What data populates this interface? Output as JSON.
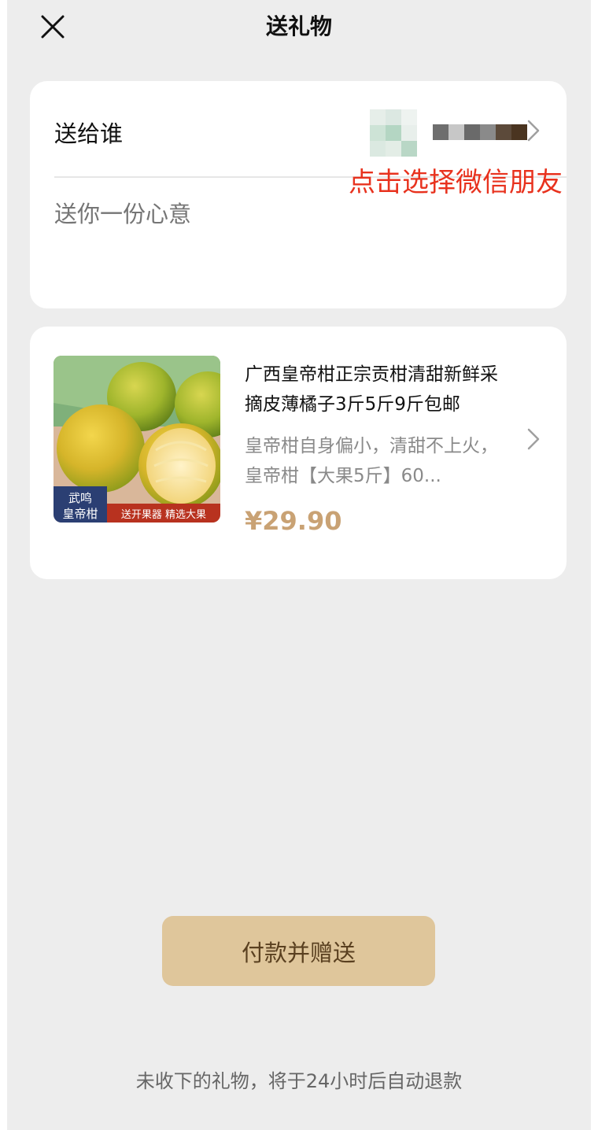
{
  "header": {
    "title": "送礼物",
    "close_icon": "close-icon"
  },
  "recipient": {
    "label": "送给谁",
    "message_placeholder": "送你一份心意",
    "avatar_colors": [
      "#e6eee9",
      "#dce8e2",
      "#eef3f0",
      "#cde3d6",
      "#b4d6c3",
      "#e8efeb",
      "#dbe9e1",
      "#e3ede6",
      "#b9d7c6"
    ],
    "name_colors": [
      "#6e6e6e",
      "#c7c7c7",
      "#6a6a6a",
      "#8a8a8a",
      "#5c4a3a",
      "#4a3420"
    ]
  },
  "annotation": "点击选择微信朋友",
  "gift": {
    "title": "广西皇帝柑正宗贡柑清甜新鲜采摘皮薄橘子3斤5斤9斤包邮",
    "description": "皇帝柑自身偏小，清甜不上火，皇帝柑【大果5斤】60...",
    "price": "¥29.90",
    "image_badge_top": "武鸣",
    "image_badge_bottom": "皇帝柑",
    "image_banner": "送开果器 精选大果"
  },
  "pay_button": "付款并赠送",
  "footer_note": "未收下的礼物，将于24小时后自动退款",
  "colors": {
    "accent_button": "#dfc69b",
    "price": "#c9a274",
    "annotation": "#e8321e",
    "background": "#ededed"
  }
}
